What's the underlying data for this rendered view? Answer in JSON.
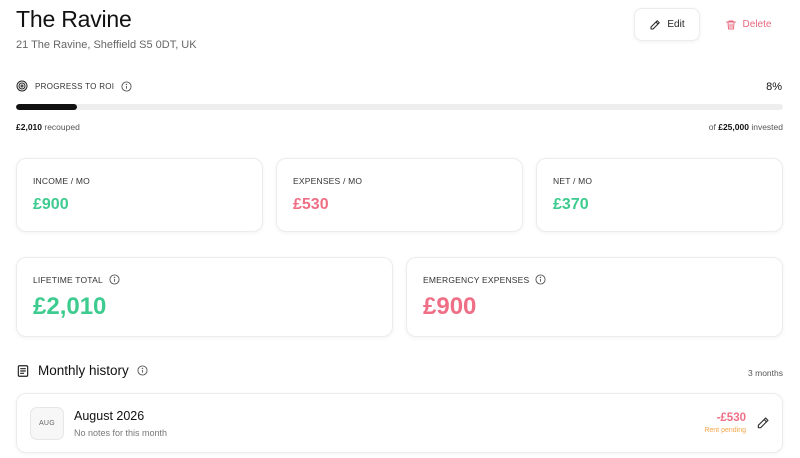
{
  "property": {
    "title": "The Ravine",
    "address": "21 The Ravine, Sheffield S5 0DT, UK"
  },
  "actions": {
    "edit_label": "Edit",
    "delete_label": "Delete"
  },
  "roi": {
    "label": "PROGRESS TO ROI",
    "percent_text": "8%",
    "progress_fraction": 0.08,
    "recouped_amount": "£2,010",
    "recouped_suffix": "recouped",
    "invested_prefix": "of",
    "invested_amount": "£25,000",
    "invested_suffix": "invested"
  },
  "stats": {
    "income_label": "INCOME / MO",
    "income_value": "£900",
    "expenses_label": "EXPENSES / MO",
    "expenses_value": "£530",
    "net_label": "NET / MO",
    "net_value": "£370",
    "lifetime_label": "LIFETIME TOTAL",
    "lifetime_value": "£2,010",
    "emergency_label": "EMERGENCY EXPENSES",
    "emergency_value": "£900"
  },
  "history": {
    "title": "Monthly history",
    "count": "3 months",
    "rows": [
      {
        "badge": "AUG",
        "month": "August 2026",
        "note": "No notes for this month",
        "amount": "-£530",
        "status": "Rent pending"
      }
    ]
  },
  "colors": {
    "positive": "#3ecb8f",
    "negative": "#ef6f86",
    "pending": "#f3a64a",
    "progress": "#111111"
  }
}
